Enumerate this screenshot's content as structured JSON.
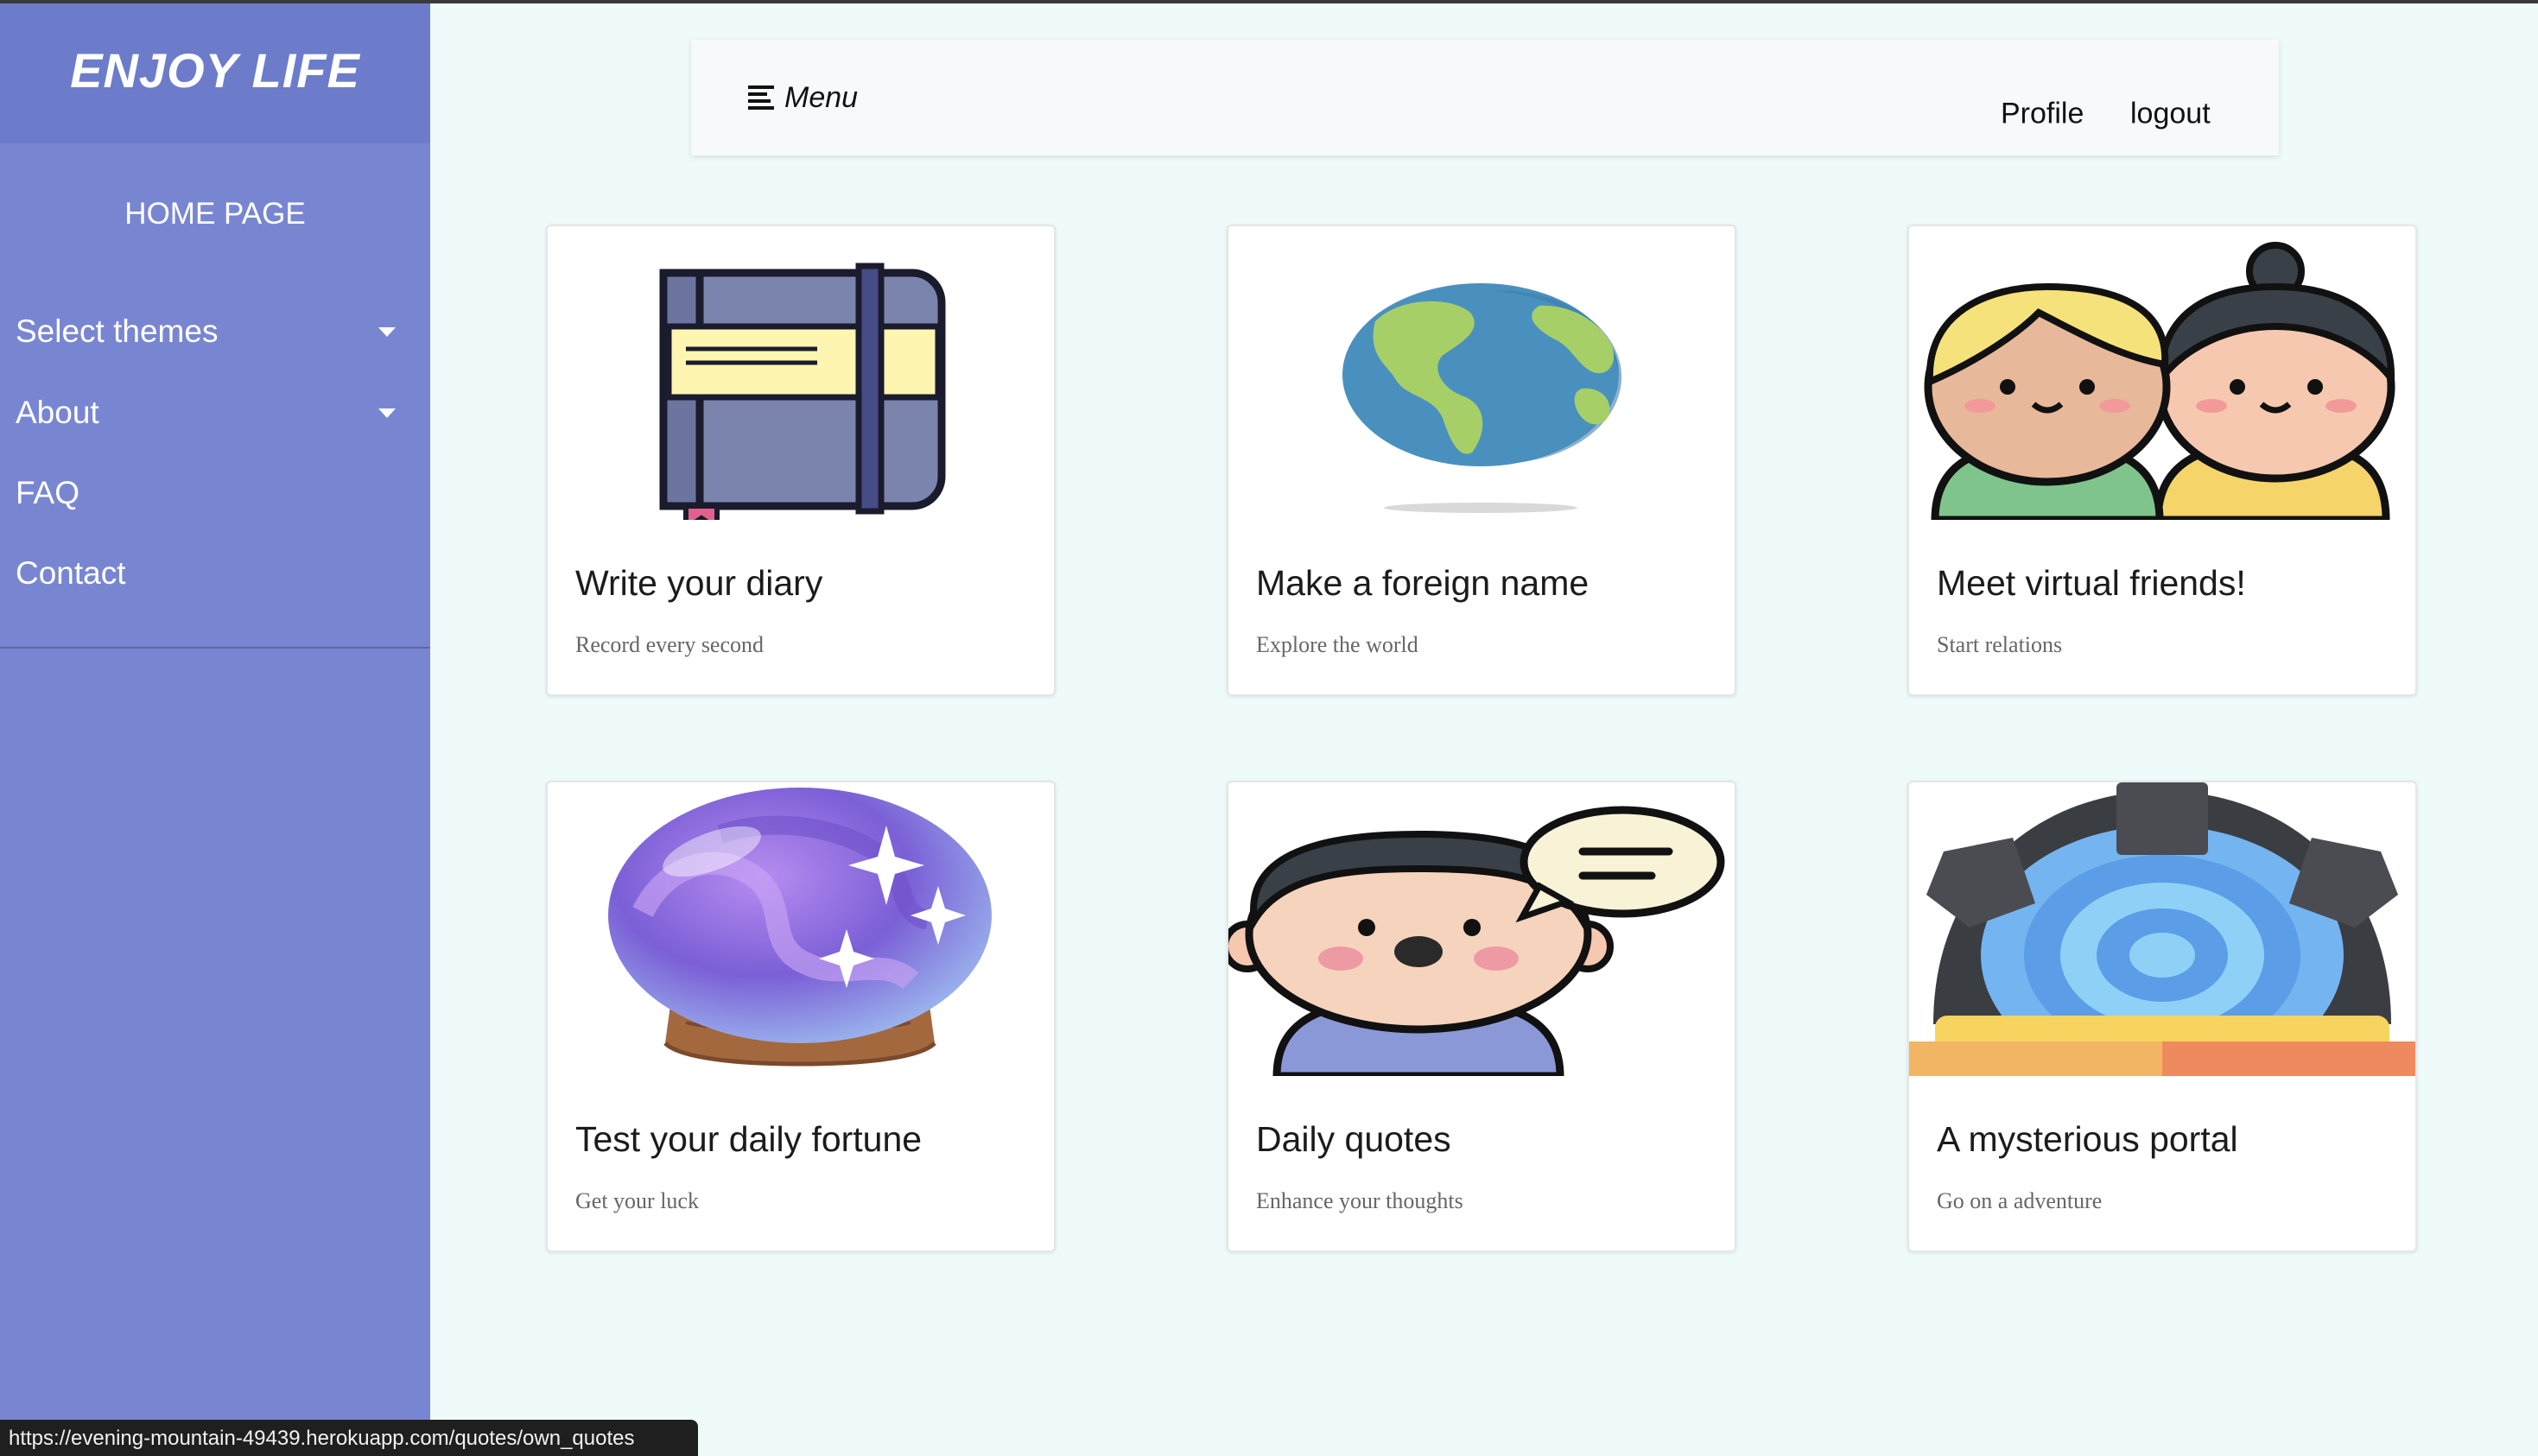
{
  "sidebar": {
    "brand": "ENJOY LIFE",
    "home": "HOME PAGE",
    "items": [
      {
        "label": "Select themes",
        "has_dropdown": true
      },
      {
        "label": "About",
        "has_dropdown": true
      },
      {
        "label": "FAQ",
        "has_dropdown": false
      },
      {
        "label": "Contact",
        "has_dropdown": false
      }
    ]
  },
  "navbar": {
    "menu_label": "Menu",
    "profile": "Profile",
    "logout": "logout"
  },
  "cards": [
    {
      "title": "Write your diary",
      "subtitle": "Record every second",
      "icon": "diary-book-icon"
    },
    {
      "title": "Make a foreign name",
      "subtitle": "Explore the world",
      "icon": "globe-icon"
    },
    {
      "title": "Meet virtual friends!",
      "subtitle": "Start relations",
      "icon": "friends-icon"
    },
    {
      "title": "Test your daily fortune",
      "subtitle": "Get your luck",
      "icon": "crystal-ball-icon"
    },
    {
      "title": "Daily quotes",
      "subtitle": "Enhance your thoughts",
      "icon": "speaking-person-icon"
    },
    {
      "title": "A mysterious portal",
      "subtitle": "Go on a adventure",
      "icon": "portal-icon"
    }
  ],
  "statusbar": {
    "url": "https://evening-mountain-49439.herokuapp.com/quotes/own_quotes"
  },
  "colors": {
    "sidebar": "#7886d2",
    "sidebar_header": "#6c7ccb",
    "background": "#effbfa",
    "navbar": "#f7f9fa"
  }
}
